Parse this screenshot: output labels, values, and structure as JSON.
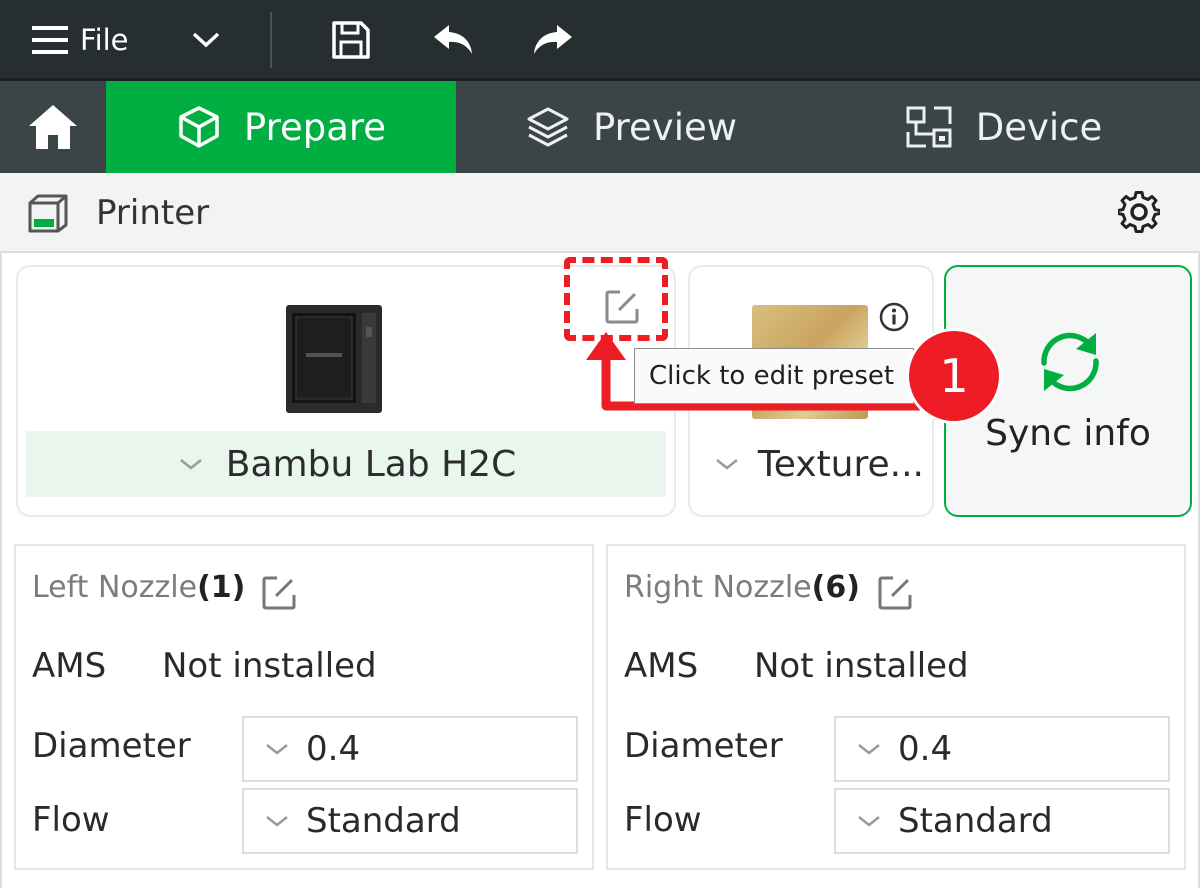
{
  "titlebar": {
    "file_label": "File",
    "menu_icon": "hamburger-icon",
    "dropdown_icon": "chevron-down-icon",
    "save_icon": "save-icon",
    "undo_icon": "undo-icon",
    "redo_icon": "redo-icon"
  },
  "tabs": [
    {
      "label": "Prepare",
      "icon": "cube-icon",
      "active": true
    },
    {
      "label": "Preview",
      "icon": "layers-icon",
      "active": false
    },
    {
      "label": "Device",
      "icon": "device-icon",
      "active": false
    }
  ],
  "panel": {
    "title": "Printer",
    "icon": "printer-icon",
    "settings_icon": "gear-icon"
  },
  "printer_card": {
    "selected": "Bambu Lab H2C",
    "edit_icon": "edit-icon"
  },
  "plate_card": {
    "selected": "Texture...",
    "info_icon": "info-icon"
  },
  "sync_card": {
    "label": "Sync info",
    "icon": "sync-icon"
  },
  "tooltip": "Click to edit preset",
  "annotation_badge": "1",
  "left_nozzle": {
    "title": "Left Nozzle",
    "count": "(1)",
    "ams_label": "AMS",
    "ams_value": "Not installed",
    "diameter_label": "Diameter",
    "diameter_value": "0.4",
    "flow_label": "Flow",
    "flow_value": "Standard"
  },
  "right_nozzle": {
    "title": "Right Nozzle",
    "count": "(6)",
    "ams_label": "AMS",
    "ams_value": "Not installed",
    "diameter_label": "Diameter",
    "diameter_value": "0.4",
    "flow_label": "Flow",
    "flow_value": "Standard"
  },
  "colors": {
    "accent": "#00ae42",
    "annotation": "#ee1c25",
    "titlebar": "#262e30",
    "tabbar": "#3b4446"
  }
}
